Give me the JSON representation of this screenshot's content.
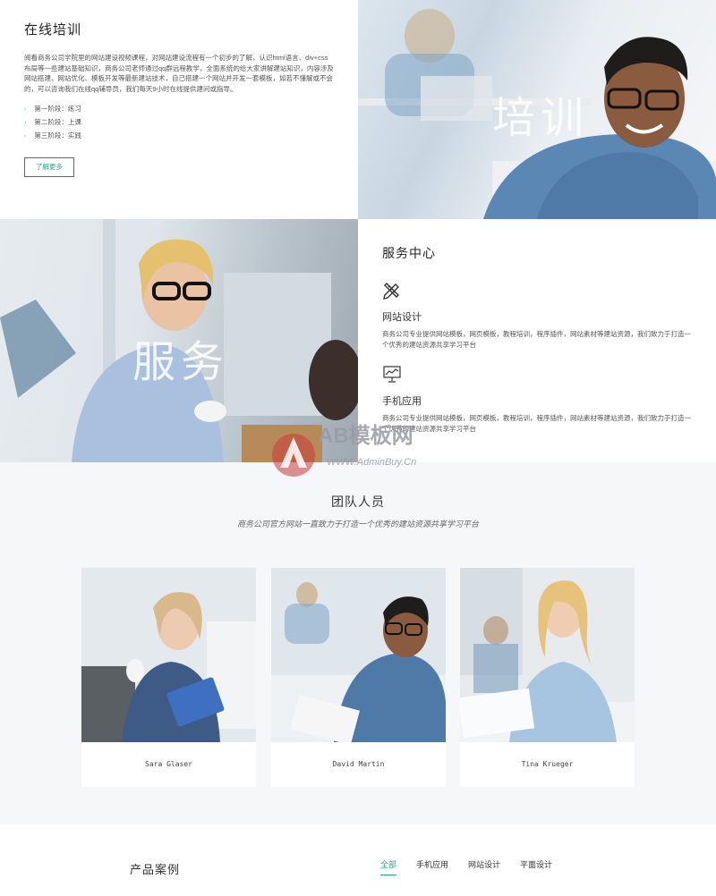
{
  "training": {
    "title": "在线培训",
    "description": "阅看商务公司学院里的网站建设视频课程，对网站建设流程有一个初步的了解，认识html语言、div+css布局等一些建站基础知识，商务公司老师通过qq群远程教学，全面系统的给大家讲解建站知识，内容涉及网站搭建、网站优化、模板开发等最新建站技术，自己搭建一个网站并开发一套模板，如若不懂解或不会的，可以咨询我们在线qq辅导员，我们每天9小时在线提供建问或指导。",
    "steps": [
      "第一阶段：练习",
      "第二阶段：上课",
      "第三阶段：实践"
    ],
    "more_label": "了解更多",
    "photo_word": "培训"
  },
  "service": {
    "title": "服务中心",
    "photo_word": "服务",
    "items": [
      {
        "icon": "pencil-ruler-icon",
        "title": "网站设计",
        "desc": "商务公司专业提供网站模板，网页模板，教程培训，程序插件，网站素材等建站资源，我们致力于打造一个优秀的建站资源共享学习平台"
      },
      {
        "icon": "chart-monitor-icon",
        "title": "手机应用",
        "desc": "商务公司专业提供网站模板，网页模板，教程培训，程序插件，网站素材等建站资源，我们致力于打造一个优秀的建站资源共享学习平台"
      }
    ]
  },
  "team": {
    "title": "团队人员",
    "subtitle": "商务公司官方网站一直致力于打造一个优秀的建站资源共享学习平台",
    "members": [
      {
        "name": "Sara Glaser"
      },
      {
        "name": "David Martin"
      },
      {
        "name": "Tina Krueger"
      }
    ]
  },
  "products": {
    "title": "产品案例",
    "tabs": [
      "全部",
      "手机应用",
      "网站设计",
      "平面设计"
    ]
  },
  "watermark": {
    "brand": "AB模板网",
    "url": "WWW.AdminBuy.Cn"
  }
}
